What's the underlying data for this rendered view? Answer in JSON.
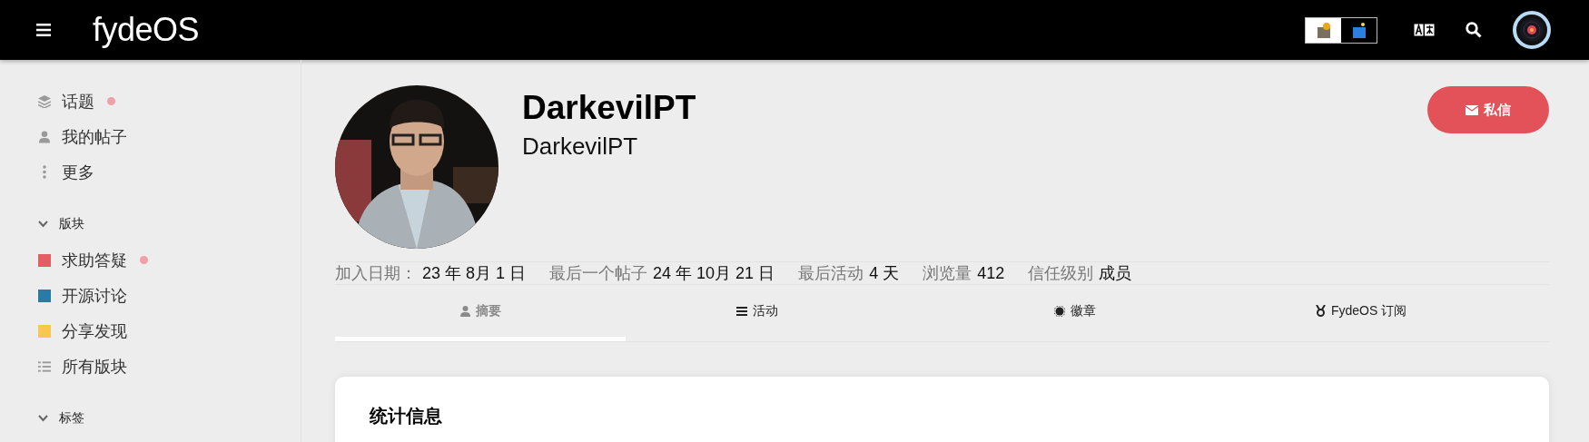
{
  "header": {
    "logo": "fydeOS",
    "theme_toggle": [
      {
        "selected": true
      },
      {
        "selected": false
      }
    ]
  },
  "sidebar": {
    "items": [
      {
        "kind": "layers",
        "label": "话题",
        "unread": true
      },
      {
        "kind": "user",
        "label": "我的帖子",
        "unread": false
      },
      {
        "kind": "more",
        "label": "更多",
        "unread": false
      }
    ],
    "sections": [
      {
        "title": "版块",
        "expanded": true,
        "items": [
          {
            "kind": "category",
            "label": "求助答疑",
            "color": "#e45f63",
            "unread": true
          },
          {
            "kind": "category",
            "label": "开源讨论",
            "color": "#2b7aa3",
            "unread": false
          },
          {
            "kind": "category",
            "label": "分享发现",
            "color": "#f9c74f",
            "unread": false
          },
          {
            "kind": "list",
            "label": "所有版块",
            "unread": false
          }
        ]
      },
      {
        "title": "标签",
        "expanded": true
      }
    ]
  },
  "profile": {
    "name": "DarkevilPT",
    "username": "DarkevilPT",
    "message_button": "私信",
    "stats": [
      {
        "label": "加入日期：",
        "value": "23 年 8月 1 日"
      },
      {
        "label": "最后一个帖子",
        "value": "24 年 10月 21 日"
      },
      {
        "label": "最后活动",
        "value": "4 天"
      },
      {
        "label": "浏览量",
        "value": "412"
      },
      {
        "label": "信任级别",
        "value": "成员"
      }
    ],
    "tabs": [
      {
        "kind": "user",
        "label": "摘要",
        "selected": true
      },
      {
        "kind": "list",
        "label": "活动",
        "selected": false
      },
      {
        "kind": "badge",
        "label": "徽章",
        "selected": false
      },
      {
        "kind": "medal",
        "label": "FydeOS 订阅",
        "selected": false
      }
    ],
    "card": {
      "title": "统计信息"
    }
  }
}
